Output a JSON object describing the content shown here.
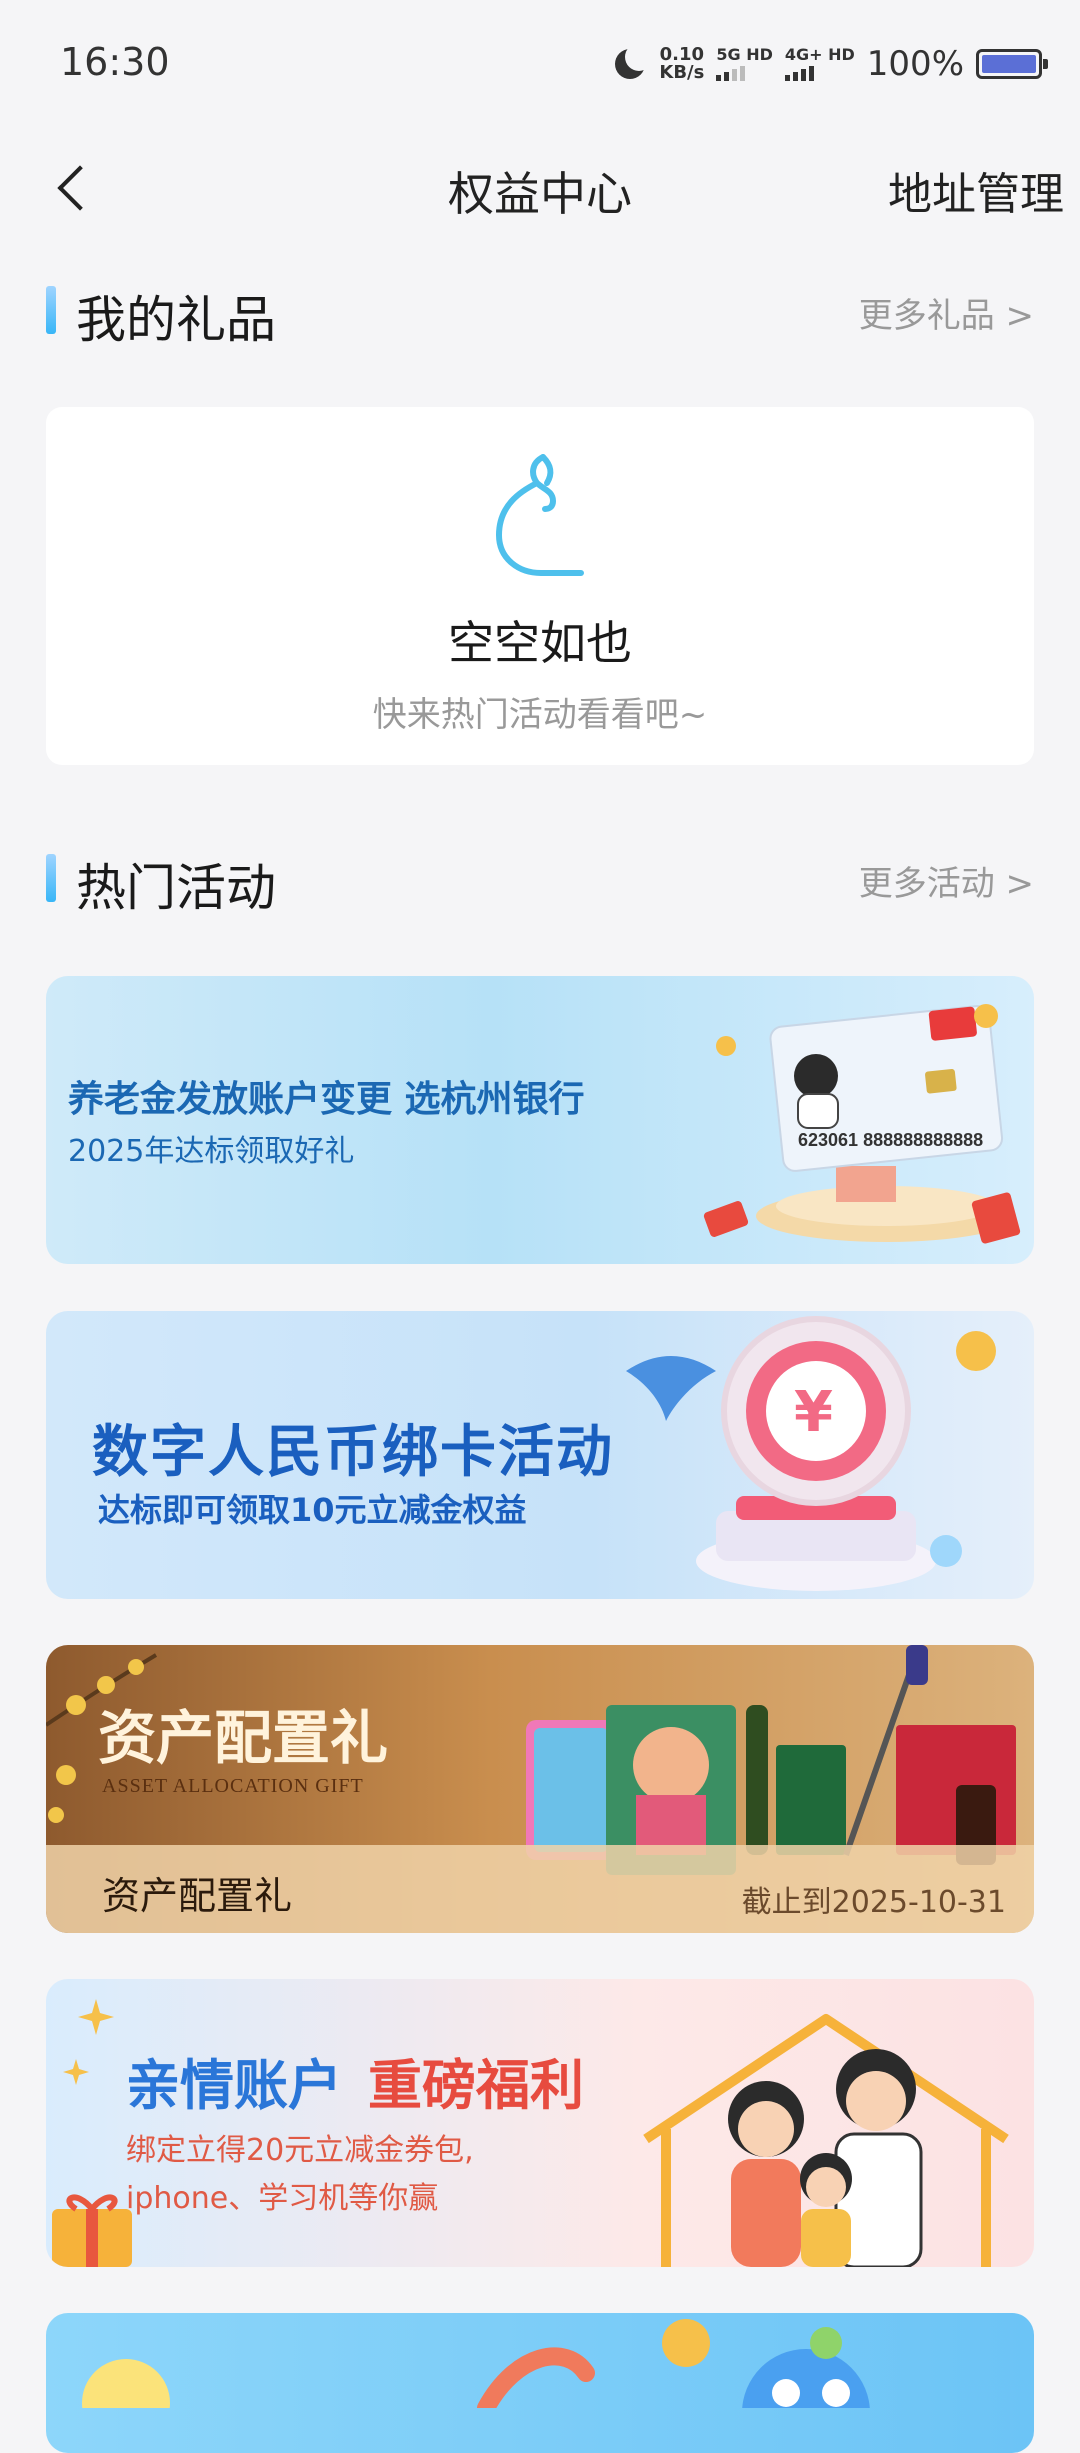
{
  "status_bar": {
    "time": "16:30",
    "net_speed_value": "0.10",
    "net_speed_unit": "KB/s",
    "sim1": "5G HD",
    "sim2": "4G+ HD",
    "battery_percent": "100%"
  },
  "nav": {
    "title": "权益中心",
    "right_action": "地址管理"
  },
  "my_gifts": {
    "title": "我的礼品",
    "more": "更多礼品 >",
    "empty_title": "空空如也",
    "empty_subtitle": "快来热门活动看看吧~"
  },
  "hot_activities": {
    "title": "热门活动",
    "more": "更多活动 >",
    "banners": [
      {
        "main": "养老金发放账户变更 选杭州银行",
        "sub": "2025年达标领取好礼",
        "card_number": "623061 888888888888"
      },
      {
        "main": "数字人民币绑卡活动",
        "sub": "达标即可领取10元立减金权益",
        "badge": "10"
      },
      {
        "main": "资产配置礼",
        "en": "ASSET ALLOCATION GIFT",
        "label": "资产配置礼",
        "deadline": "截止到2025-10-31"
      },
      {
        "main_part1": "亲情账户",
        "main_part2": "重磅福利",
        "sub_line1": "绑定立得20元立减金券包,",
        "sub_line2": "iphone、学习机等你赢"
      }
    ]
  }
}
